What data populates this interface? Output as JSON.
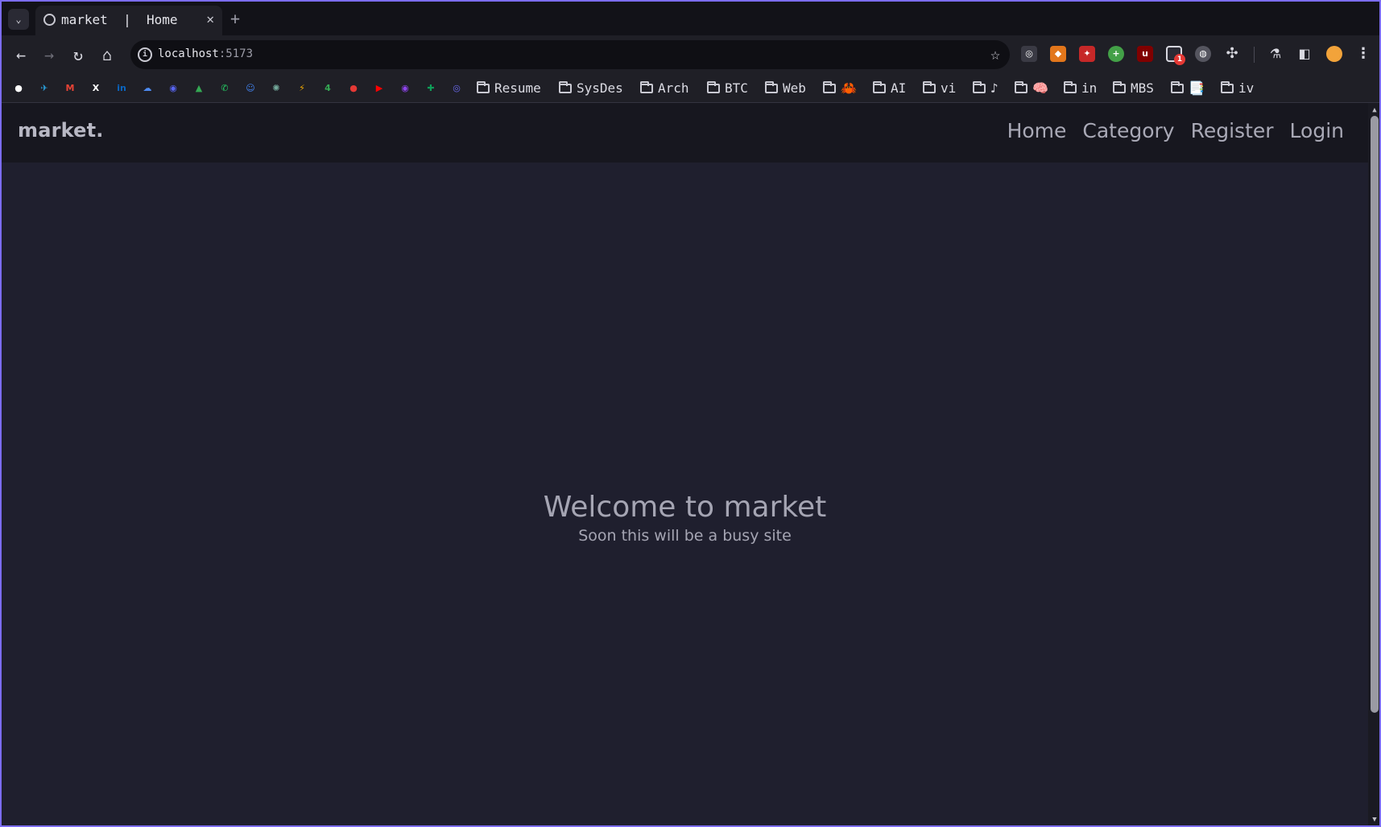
{
  "browser": {
    "tab": {
      "title": "market  |  Home",
      "close_glyph": "✕"
    },
    "new_tab_glyph": "+",
    "tab_list_glyph": "⌄",
    "nav": {
      "back": "←",
      "forward": "→",
      "reload": "↻",
      "home": "⌂"
    },
    "omnibox": {
      "host": "localhost",
      "port": ":5173",
      "info_glyph": "i",
      "star_glyph": "☆"
    },
    "extensions_badge": "1",
    "menu_glyph": "⋮",
    "bookmark_folders": [
      "Resume",
      "SysDes",
      "Arch",
      "BTC",
      "Web",
      "🦀",
      "AI",
      "vi",
      "♪",
      "🧠",
      "in",
      "MBS",
      "📑",
      "iv"
    ],
    "bookmark_icons": [
      {
        "name": "github",
        "glyph": "●",
        "color": "#ffffff"
      },
      {
        "name": "telegram",
        "glyph": "✈",
        "color": "#2aa3e0"
      },
      {
        "name": "gmail",
        "glyph": "M",
        "color": "#ea4335"
      },
      {
        "name": "x",
        "glyph": "X",
        "color": "#ffffff"
      },
      {
        "name": "linkedin",
        "glyph": "in",
        "color": "#0a66c2"
      },
      {
        "name": "cloud",
        "glyph": "☁",
        "color": "#4d8af0"
      },
      {
        "name": "discord",
        "glyph": "◉",
        "color": "#5865f2"
      },
      {
        "name": "drive",
        "glyph": "▲",
        "color": "#34a853"
      },
      {
        "name": "whatsapp",
        "glyph": "✆",
        "color": "#25d366"
      },
      {
        "name": "contacts",
        "glyph": "☺",
        "color": "#4285f4"
      },
      {
        "name": "chatgpt",
        "glyph": "✺",
        "color": "#74aa9c"
      },
      {
        "name": "lightning",
        "glyph": "⚡",
        "color": "#f2a900"
      },
      {
        "name": "four",
        "glyph": "4",
        "color": "#34a853"
      },
      {
        "name": "todoist",
        "glyph": "●",
        "color": "#e53935"
      },
      {
        "name": "youtube",
        "glyph": "▶",
        "color": "#ff0000"
      },
      {
        "name": "proton",
        "glyph": "◉",
        "color": "#8e44ec"
      },
      {
        "name": "sheets",
        "glyph": "✚",
        "color": "#0f9d58"
      },
      {
        "name": "spiral",
        "glyph": "◎",
        "color": "#6a6af0"
      }
    ]
  },
  "site": {
    "brand": "market.",
    "nav_links": [
      "Home",
      "Category",
      "Register",
      "Login"
    ],
    "hero": {
      "title": "Welcome to market",
      "subtitle": "Soon this will be a busy site"
    }
  }
}
